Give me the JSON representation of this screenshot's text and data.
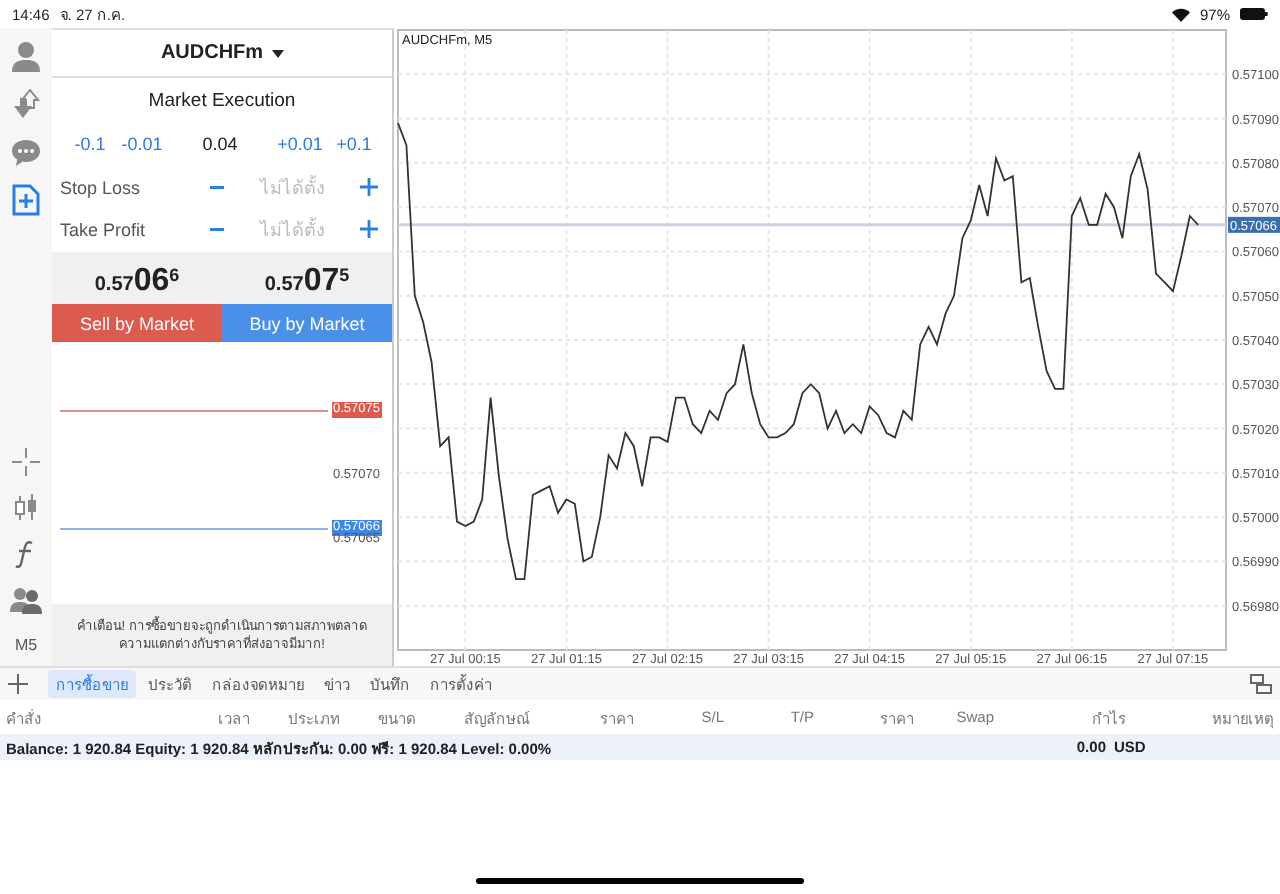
{
  "status_bar": {
    "time": "14:46",
    "date": "จ. 27 ก.ค.",
    "battery": "97%"
  },
  "sidebar": {
    "items": [
      {
        "kind": "account",
        "selected": false
      },
      {
        "kind": "trade",
        "selected": false
      },
      {
        "kind": "chat",
        "selected": false
      },
      {
        "kind": "new_order",
        "selected": true
      }
    ],
    "tools": [
      {
        "kind": "crosshair"
      },
      {
        "kind": "candles"
      },
      {
        "kind": "indicator"
      },
      {
        "kind": "objects"
      }
    ],
    "timeframe": "M5"
  },
  "order": {
    "symbol": "AUDCHFm",
    "execution": "Market Execution",
    "volume": {
      "decrease": [
        "-0.1",
        "-0.01"
      ],
      "value": "0.04",
      "increase": [
        "+0.01",
        "+0.1"
      ]
    },
    "stops": [
      {
        "label": "Stop Loss",
        "value": "ไม่ได้ตั้ง"
      },
      {
        "label": "Take Profit",
        "value": "ไม่ได้ตั้ง"
      }
    ],
    "bid": {
      "prefix": "0.57",
      "big": "06",
      "sup": "6"
    },
    "ask": {
      "prefix": "0.57",
      "big": "07",
      "sup": "5"
    },
    "sell_button": "Sell by Market",
    "buy_button": "Buy by Market",
    "levels": [
      {
        "kind": "sell_line",
        "price": "0.57075"
      },
      {
        "kind": "grid",
        "price": "0.57070"
      },
      {
        "kind": "buy_line",
        "price": "0.57066"
      },
      {
        "kind": "grid",
        "price": "0.57065"
      }
    ],
    "warning": [
      "คำเตือน! การซื้อขายจะถูกดำเนินการตามสภาพตลาด",
      "ความแตกต่างกับราคาที่ส่งอาจมีมาก!"
    ]
  },
  "chart": {
    "current_price": "0.57066",
    "chart_data": {
      "type": "line",
      "title": "AUDCHFm, M5",
      "grid": true,
      "ylim": [
        0.5697,
        0.5711
      ],
      "categories": [
        null,
        null,
        null,
        null,
        null,
        null,
        null,
        null,
        "27 Jul 00:15",
        null,
        null,
        null,
        null,
        null,
        null,
        null,
        null,
        null,
        null,
        null,
        "27 Jul 01:15",
        null,
        null,
        null,
        null,
        null,
        null,
        null,
        null,
        null,
        null,
        null,
        "27 Jul 02:15",
        null,
        null,
        null,
        null,
        null,
        null,
        null,
        null,
        null,
        null,
        null,
        "27 Jul 03:15",
        null,
        null,
        null,
        null,
        null,
        null,
        null,
        null,
        null,
        null,
        null,
        "27 Jul 04:15",
        null,
        null,
        null,
        null,
        null,
        null,
        null,
        null,
        null,
        null,
        null,
        "27 Jul 05:15",
        null,
        null,
        null,
        null,
        null,
        null,
        null,
        null,
        null,
        null,
        null,
        "27 Jul 06:15",
        null,
        null,
        null,
        null,
        null,
        null,
        null,
        null,
        null,
        null,
        null,
        "27 Jul 07:15",
        null,
        null,
        null
      ],
      "yticks": [
        {
          "value": 0.5698,
          "label": "0.56980"
        },
        {
          "value": 0.5699,
          "label": "0.56990"
        },
        {
          "value": 0.57,
          "label": "0.57000"
        },
        {
          "value": 0.5701,
          "label": "0.57010"
        },
        {
          "value": 0.5702,
          "label": "0.57020"
        },
        {
          "value": 0.5703,
          "label": "0.57030"
        },
        {
          "value": 0.5704,
          "label": "0.57040"
        },
        {
          "value": 0.5705,
          "label": "0.57050"
        },
        {
          "value": 0.5706,
          "label": "0.57060"
        },
        {
          "value": 0.5707,
          "label": "0.57070"
        },
        {
          "value": 0.5708,
          "label": "0.57080"
        },
        {
          "value": 0.5709,
          "label": "0.57090"
        },
        {
          "value": 0.571,
          "label": "0.57100"
        }
      ],
      "series": [
        {
          "color": "#333333",
          "values": [
            0.57089,
            0.57084,
            0.5705,
            0.57044,
            0.57035,
            0.57016,
            0.57018,
            0.56999,
            0.56998,
            0.56999,
            0.57004,
            0.57027,
            0.57009,
            0.56995,
            0.56986,
            0.56986,
            0.57005,
            0.57006,
            0.57007,
            0.57001,
            0.57004,
            0.57003,
            0.5699,
            0.56991,
            0.57,
            0.57014,
            0.57011,
            0.57019,
            0.57016,
            0.57007,
            0.57018,
            0.57018,
            0.57017,
            0.57027,
            0.57027,
            0.57021,
            0.57019,
            0.57024,
            0.57022,
            0.57028,
            0.5703,
            0.57039,
            0.57028,
            0.57021,
            0.57018,
            0.57018,
            0.57019,
            0.57021,
            0.57028,
            0.5703,
            0.57028,
            0.5702,
            0.57024,
            0.57019,
            0.57021,
            0.57019,
            0.57025,
            0.57023,
            0.57019,
            0.57018,
            0.57024,
            0.57022,
            0.57039,
            0.57043,
            0.57039,
            0.57046,
            0.5705,
            0.57063,
            0.57067,
            0.57075,
            0.57068,
            0.57081,
            0.57076,
            0.57077,
            0.57053,
            0.57054,
            0.57043,
            0.57033,
            0.57029,
            0.57029,
            0.57068,
            0.57072,
            0.57066,
            0.57066,
            0.57073,
            0.5707,
            0.57063,
            0.57077,
            0.57082,
            0.57074,
            0.57055,
            0.57053,
            0.57051,
            0.57059,
            0.57068,
            0.57066
          ]
        }
      ],
      "ref_lines": [
        {
          "axis": "y",
          "value": 0.57066
        }
      ]
    }
  },
  "tabs": [
    {
      "label": "การซื้อขาย",
      "selected": true
    },
    {
      "label": "ประวัติ",
      "selected": false
    },
    {
      "label": "กล่องจดหมาย",
      "selected": false
    },
    {
      "label": "ข่าว",
      "selected": false
    },
    {
      "label": "บันทึก",
      "selected": false
    },
    {
      "label": "การตั้งค่า",
      "selected": false
    }
  ],
  "table": {
    "columns": [
      "คำสั่ง",
      "เวลา",
      "ประเภท",
      "ขนาด",
      "สัญลักษณ์",
      "ราคา",
      "S/L",
      "T/P",
      "ราคา",
      "Swap",
      "กำไร",
      "หมายเหตุ"
    ],
    "summary": {
      "text": "Balance: 1 920.84 Equity: 1 920.84 หลักประกัน: 0.00 ฟรี: 1 920.84 Level: 0.00%",
      "profit": "0.00",
      "currency": "USD"
    }
  }
}
